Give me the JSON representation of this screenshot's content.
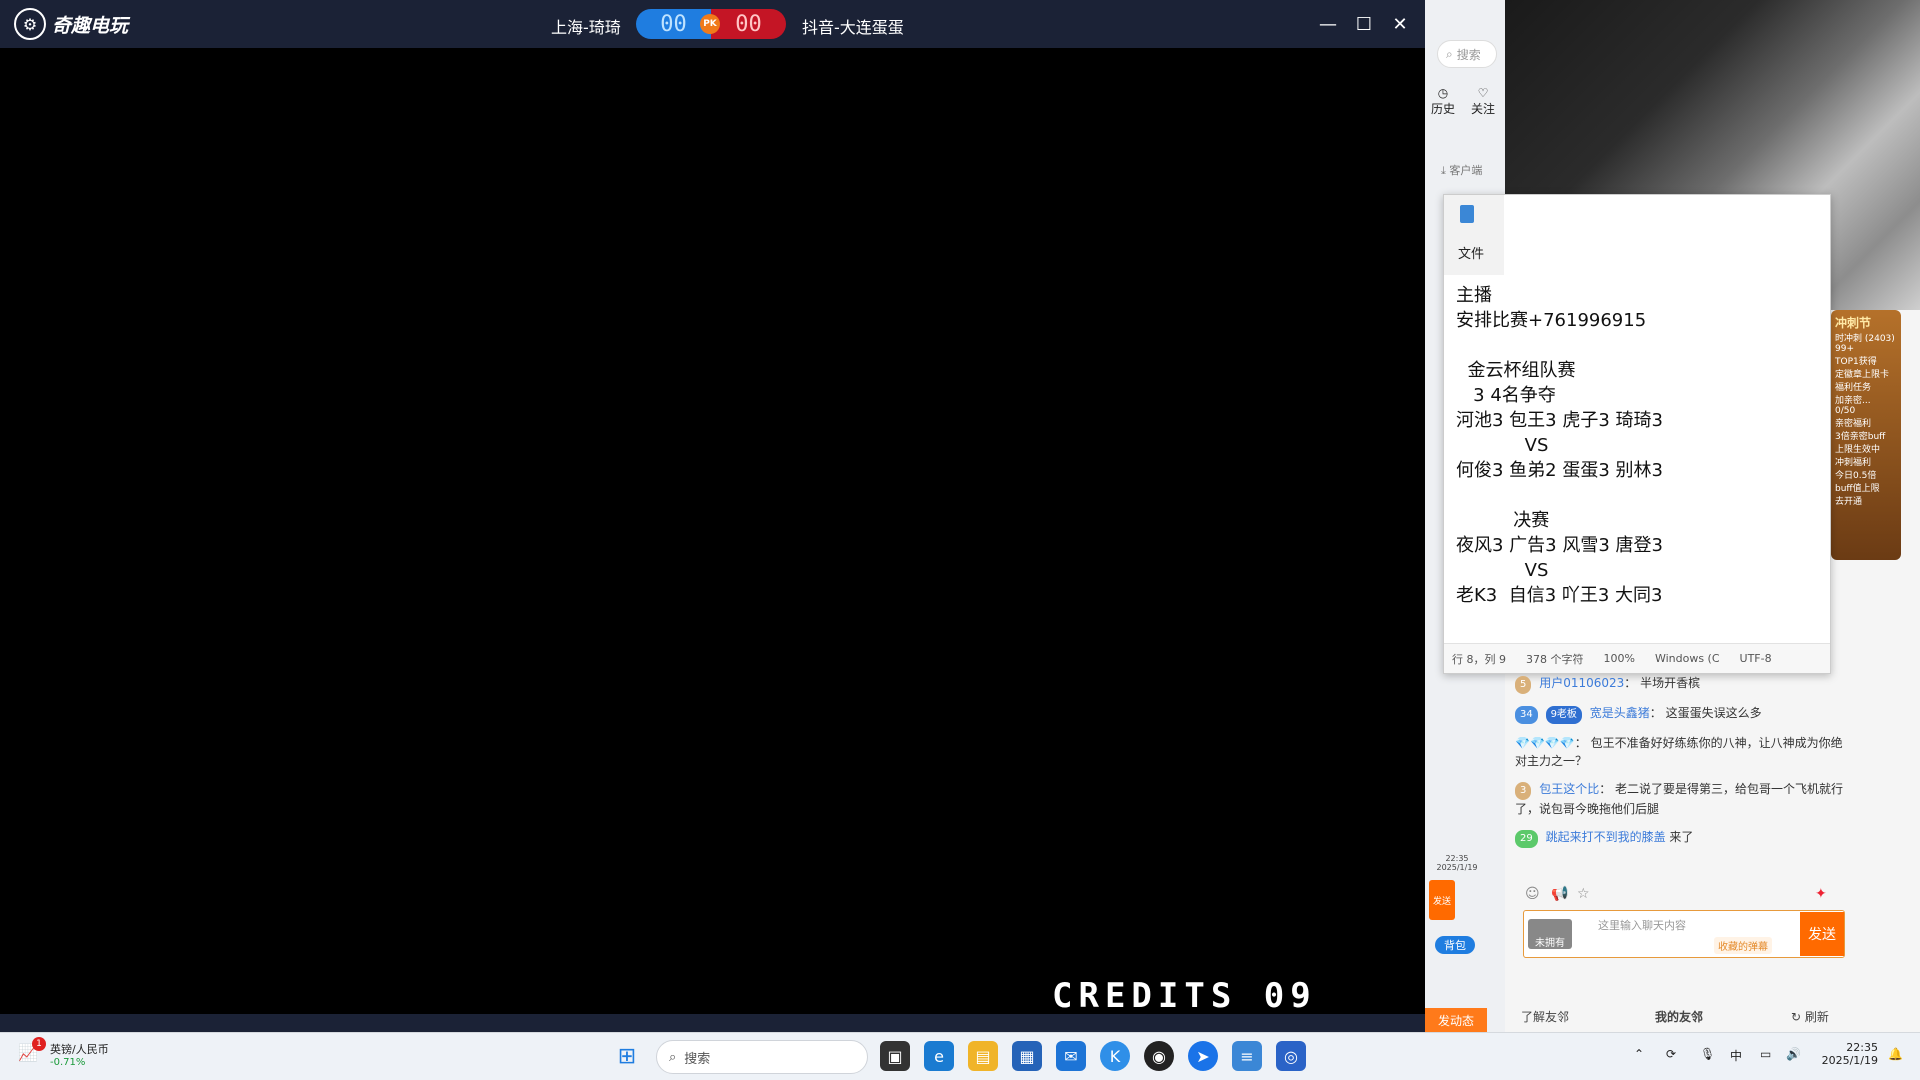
{
  "game_window": {
    "brand": "奇趣电玩",
    "player_left": "上海-琦琦",
    "score_left": "00",
    "pk_label": "PK",
    "score_right": "00",
    "player_right": "抖音-大连蛋蛋",
    "credits": "CREDITS 09",
    "controls": {
      "minimize": "—",
      "maximize": "☐",
      "close": "✕"
    }
  },
  "browser": {
    "search_placeholder": "搜索",
    "nav": [
      {
        "label": "历史",
        "icon": "clock-icon"
      },
      {
        "label": "关注",
        "icon": "heart-icon"
      }
    ],
    "client_label": "客户端"
  },
  "notepad": {
    "menu_file": "文件",
    "text": "主播\n安排比赛+761996915\n\n  金云杯组队赛\n   3 4名争夺\n河池3 包王3 虎子3 琦琦3\n            VS\n何俊3 鱼弟2 蛋蛋3 别林3\n\n          决赛\n夜风3 广告3 风雪3 唐登3\n            VS\n老K3  自信3 吖王3 大同3",
    "status": {
      "position": "行 8，列 9",
      "chars": "378 个字符",
      "zoom": "100%",
      "eol": "Windows (C",
      "encoding": "UTF-8"
    }
  },
  "chat": {
    "messages": [
      {
        "level": "5",
        "user": "用户01106023",
        "text": "半场开香槟"
      },
      {
        "level": "34",
        "badge": "9老板",
        "user": "宽是头鑫猪",
        "text": "这蛋蛋失误这么多"
      },
      {
        "level": "",
        "user": "💎💎💎💎",
        "text": "包王不准备好好练练你的八神，让八神成为你绝对主力之一？"
      },
      {
        "level": "3",
        "user": "包王这个比",
        "text": "老二说了要是得第三，给包哥一个飞机就行了，说包哥今晚拖他们后腿"
      },
      {
        "level": "29",
        "user": "跳起来打不到我的膝盖",
        "text": "来了"
      }
    ],
    "input_placeholder": "这里输入聊天内容",
    "danmu_label": "收藏的弹幕",
    "not_owned": "未拥有",
    "send": "发送",
    "bag": "背包",
    "friends_learn": "了解友邻",
    "friends_my": "我的友邻",
    "friends_refresh": "刷新",
    "dynamic": "发动态"
  },
  "promo": {
    "title": "冲刺节",
    "lines": [
      "时冲刺 (2403)",
      "99+",
      "TOP1获得",
      "定徽章上限卡",
      "福利任务",
      "加亲密...",
      "0/50",
      "亲密福利",
      "3倍亲密buff",
      "上限生效中",
      "冲刺福利",
      "今日0.5倍",
      "buff值上限",
      "去开通"
    ]
  },
  "taskbar": {
    "stock_name": "英镑/人民币",
    "stock_change": "-0.71%",
    "stock_badge": "1",
    "search": "搜索",
    "ime": "中",
    "time": "22:35",
    "date": "2025/1/19",
    "mini_time": "22:35",
    "mini_date": "2025/1/19"
  }
}
